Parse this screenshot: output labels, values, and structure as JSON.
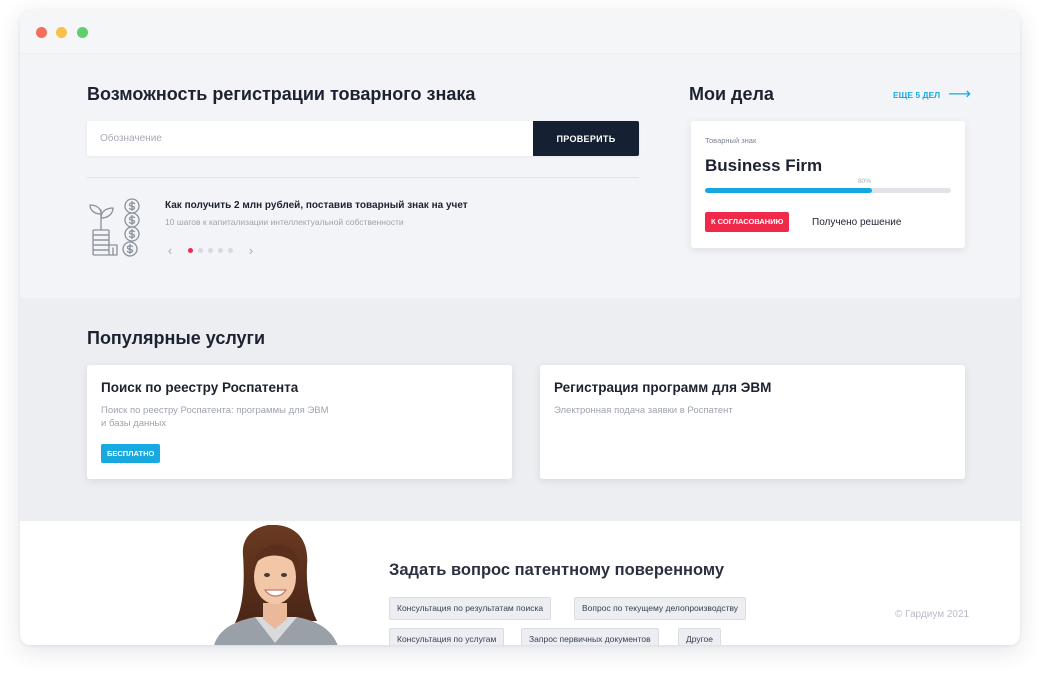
{
  "trademark_check": {
    "title": "Возможность регистрации товарного знака",
    "input_placeholder": "Обозначение",
    "input_value": "",
    "button_label": "ПРОВЕРИТЬ"
  },
  "promo": {
    "icon": "coins-plant-icon",
    "title": "Как получить 2 млн рублей, поставив товарный знак на учет",
    "subtitle": "10 шагов к капитализации интеллектуальной собственности",
    "prev": "‹",
    "next": "›",
    "slides_total": 5,
    "active_slide": 0
  },
  "my_cases": {
    "title": "Мои дела",
    "more_label": "ЕЩЕ 5 ДЕЛ",
    "more_arrow": "⟶",
    "card": {
      "type": "Товарный знак",
      "name": "Business Firm",
      "progress_label": "80%",
      "progress_fill": 0.68,
      "badge": "К СОГЛАСОВАНИЮ",
      "status": "Получено решение"
    }
  },
  "services": {
    "title": "Популярные услуги",
    "items": [
      {
        "title": "Поиск по реестру Роспатента",
        "desc": "Поиск по реестру Роспатента: программы для ЭВМ и базы данных",
        "badge": "БЕСПЛАТНО"
      },
      {
        "title": "Регистрация программ для ЭВМ",
        "desc": "Электронная подача заявки в Роспатент"
      }
    ]
  },
  "ask": {
    "title": "Задать вопрос патентному поверенному",
    "chips": [
      "Консультация по результатам поиска",
      "Вопрос по текущему делопроизводству",
      "Консультация по услугам",
      "Запрос первичных документов",
      "Другое"
    ],
    "copyright": "© Гардиум 2021"
  },
  "colors": {
    "dark_button": "#152132",
    "accent_blue": "#18a9e0",
    "accent_red": "#f0284a",
    "page_bg": "#f3f4f7"
  }
}
